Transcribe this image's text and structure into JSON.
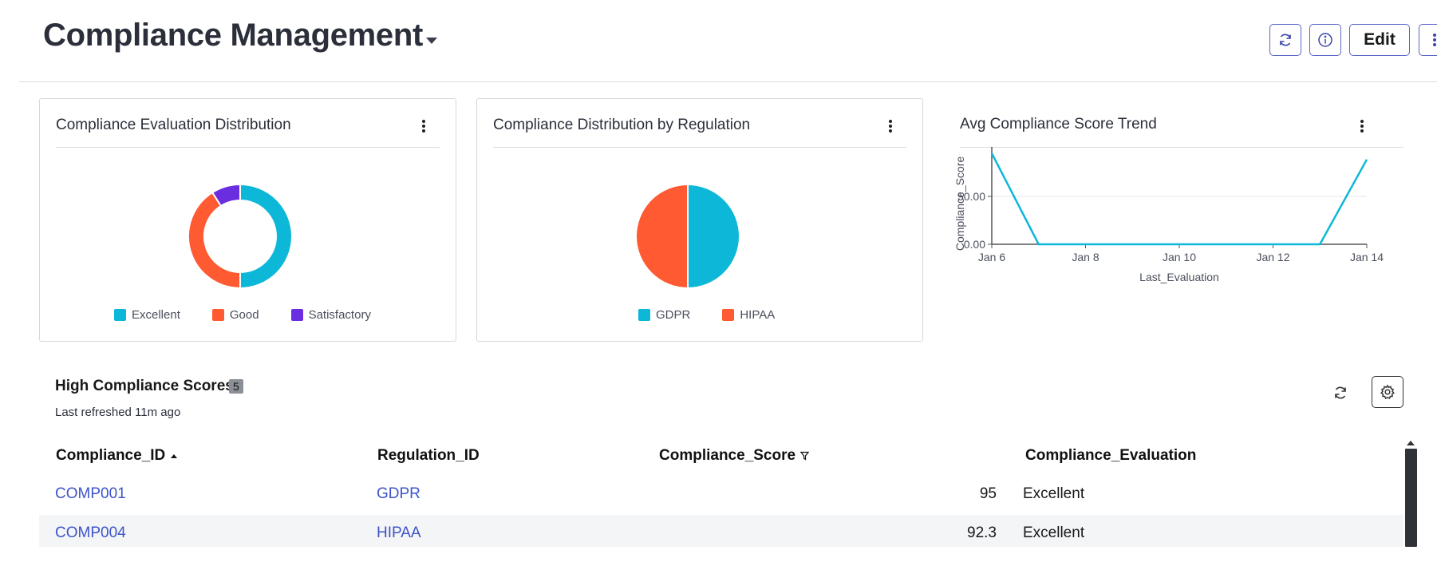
{
  "header": {
    "title": "Compliance Management",
    "edit_label": "Edit",
    "refresh_icon": "refresh-icon",
    "info_icon": "info-icon",
    "more_icon": "more-vertical-icon"
  },
  "colors": {
    "cyan": "#0db7d8",
    "orange": "#ff5a32",
    "purple": "#6a2de0",
    "accent": "#3d54c8"
  },
  "cards": {
    "evaluation": {
      "title": "Compliance Evaluation Distribution",
      "legend": [
        "Excellent",
        "Good",
        "Satisfactory"
      ]
    },
    "regulation": {
      "title": "Compliance Distribution by Regulation",
      "legend": [
        "GDPR",
        "HIPAA"
      ]
    },
    "trend": {
      "title": "Avg Compliance Score Trend"
    }
  },
  "chart_data": [
    {
      "type": "pie",
      "variant": "donut",
      "title": "Compliance Evaluation Distribution",
      "categories": [
        "Excellent",
        "Good",
        "Satisfactory"
      ],
      "values": [
        50,
        41,
        9
      ],
      "colors": [
        "#0db7d8",
        "#ff5a32",
        "#6a2de0"
      ],
      "legend": "bottom"
    },
    {
      "type": "pie",
      "title": "Compliance Distribution by Regulation",
      "categories": [
        "GDPR",
        "HIPAA"
      ],
      "values": [
        50,
        50
      ],
      "colors": [
        "#0db7d8",
        "#ff5a32"
      ],
      "legend": "bottom"
    },
    {
      "type": "line",
      "title": "Avg Compliance Score Trend",
      "xlabel": "Last_Evaluation",
      "ylabel": "Compliance_Score",
      "x": [
        "Jan 6",
        "Jan 7",
        "Jan 8",
        "Jan 9",
        "Jan 10",
        "Jan 11",
        "Jan 12",
        "Jan 13",
        "Jan 14"
      ],
      "xticks": [
        "Jan 6",
        "Jan 8",
        "Jan 10",
        "Jan 12",
        "Jan 14"
      ],
      "yticks": [
        "0.00",
        "50.00"
      ],
      "series": [
        {
          "values": [
            95,
            0,
            0,
            0,
            0,
            0,
            0,
            0,
            88.5
          ]
        }
      ],
      "ylim": [
        0,
        95
      ],
      "grid": true,
      "color": "#0db7d8"
    }
  ],
  "table": {
    "title": "High Compliance Scores",
    "count": "5",
    "refreshed": "Last refreshed 11m ago",
    "columns": [
      "Compliance_ID",
      "Regulation_ID",
      "Compliance_Score",
      "Compliance_Evaluation"
    ],
    "rows": [
      {
        "id": "COMP001",
        "reg": "GDPR",
        "score": "95",
        "eval": "Excellent"
      },
      {
        "id": "COMP004",
        "reg": "HIPAA",
        "score": "92.3",
        "eval": "Excellent"
      }
    ]
  }
}
